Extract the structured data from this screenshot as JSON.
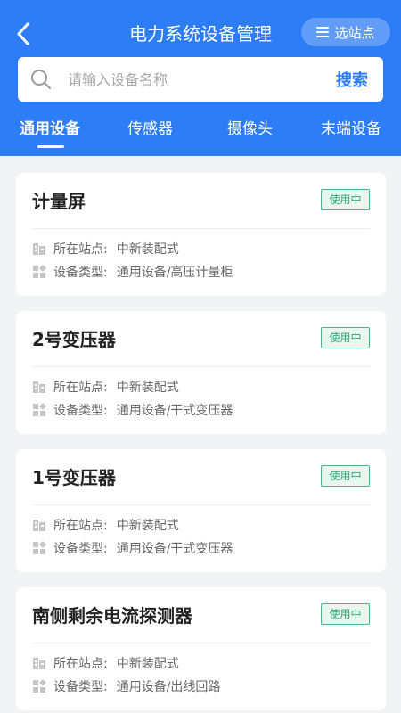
{
  "header": {
    "title": "电力系统设备管理",
    "station_button_label": "选站点",
    "back_icon": "chevron-left-icon",
    "station_icon": "menu-icon"
  },
  "search": {
    "placeholder": "请输入设备名称",
    "value": "",
    "button_label": "搜索"
  },
  "tabs": [
    {
      "label": "通用设备",
      "active": true
    },
    {
      "label": "传感器",
      "active": false
    },
    {
      "label": "摄像头",
      "active": false
    },
    {
      "label": "末端设备",
      "active": false
    }
  ],
  "devices": [
    {
      "name": "计量屏",
      "status": "使用中",
      "station_label": "所在站点:",
      "station": "中新装配式",
      "type_label": "设备类型:",
      "type": "通用设备/高压计量柜"
    },
    {
      "name": "2号变压器",
      "status": "使用中",
      "station_label": "所在站点:",
      "station": "中新装配式",
      "type_label": "设备类型:",
      "type": "通用设备/干式变压器"
    },
    {
      "name": "1号变压器",
      "status": "使用中",
      "station_label": "所在站点:",
      "station": "中新装配式",
      "type_label": "设备类型:",
      "type": "通用设备/干式变压器"
    },
    {
      "name": "南侧剩余电流探测器",
      "status": "使用中",
      "station_label": "所在站点:",
      "station": "中新装配式",
      "type_label": "设备类型:",
      "type": "通用设备/出线回路"
    }
  ],
  "colors": {
    "primary": "#2d7df6",
    "status_green": "#2aa873",
    "background": "#f2f3f5"
  }
}
